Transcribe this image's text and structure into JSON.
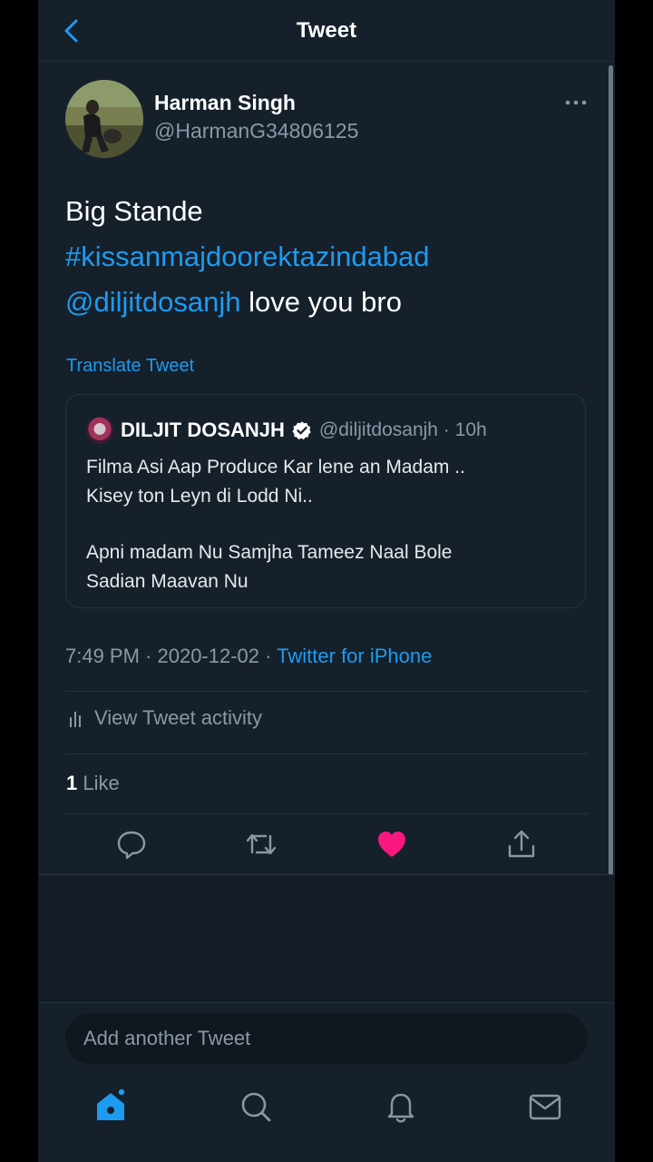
{
  "header": {
    "title": "Tweet"
  },
  "author": {
    "name": "Harman Singh",
    "handle": "@HarmanG34806125"
  },
  "tweet": {
    "line1": "Big Stande",
    "hashtag": "#kissanmajdoorektazindabad",
    "mention": "@diljitdosanjh",
    "line3_rest": " love you bro",
    "translate_label": "Translate Tweet"
  },
  "quote": {
    "name": "DILJIT DOSANJH",
    "handle_time": "@diljitdosanjh · 10h",
    "para1_line1": "Filma Asi Aap Produce Kar lene an Madam ..",
    "para1_line2": "Kisey ton Leyn di Lodd Ni..",
    "para2_line1": "Apni madam Nu Samjha Tameez Naal Bole",
    "para2_line2": "Sadian Maavan Nu"
  },
  "meta": {
    "time_date": "7:49 PM · 2020-12-02 · ",
    "source": "Twitter for iPhone"
  },
  "activity": {
    "label": "View Tweet activity"
  },
  "likes": {
    "count": "1",
    "label": " Like"
  },
  "compose": {
    "placeholder": "Add another Tweet"
  },
  "colors": {
    "accent": "#1d9bf0",
    "like": "#f91880",
    "background": "#15202b",
    "muted": "#8899a6"
  },
  "icons": {
    "back": "chevron-left-icon",
    "more": "more-horizontal-icon",
    "verified": "verified-badge-icon",
    "activity": "bar-chart-icon",
    "reply": "reply-icon",
    "retweet": "retweet-icon",
    "like": "heart-filled-icon",
    "share": "share-icon",
    "home": "home-icon",
    "search": "search-icon",
    "notifications": "bell-icon",
    "messages": "mail-icon"
  }
}
